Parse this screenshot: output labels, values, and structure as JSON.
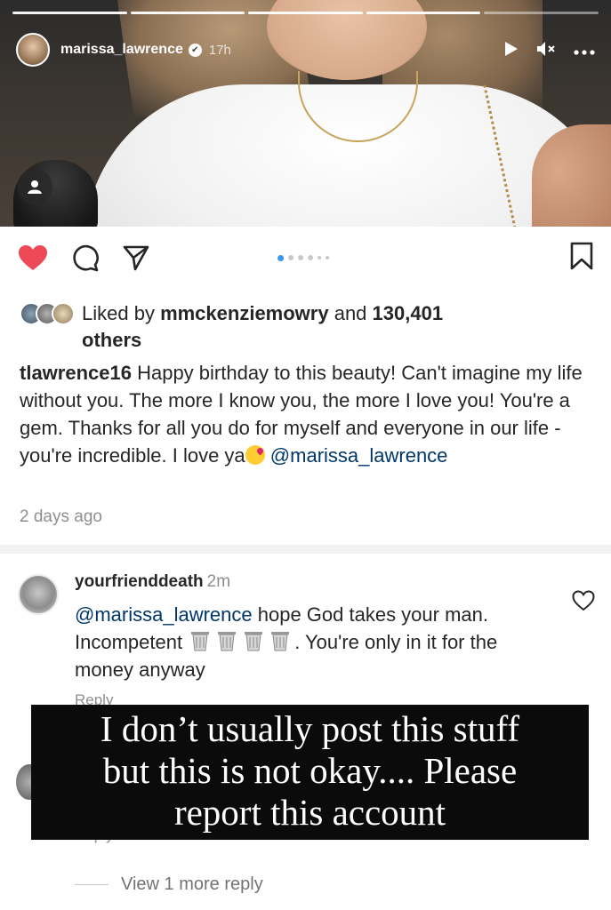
{
  "story": {
    "username": "marissa_lawrence",
    "time": "17h",
    "verified_mark": "✔",
    "progress_segments": [
      1,
      1,
      1,
      1,
      0
    ],
    "icons": [
      "play-icon",
      "mute-icon",
      "more-icon",
      "person-tag-icon"
    ]
  },
  "post": {
    "dots": [
      "active",
      "normal",
      "normal",
      "normal",
      "small",
      "small"
    ],
    "likes": {
      "prefix": "Liked by ",
      "user": "mmckenziemowry",
      "middle": " and ",
      "count": "130,401",
      "suffix": "others"
    },
    "caption": {
      "username": "tlawrence16",
      "text": " Happy birthday to this beauty! Can't imagine my life without you. The more I know you, the more I love you! You're a gem. Thanks for all you do for myself and everyone in our life - you're incredible. I love ya",
      "mention": "@marissa_lawrence"
    },
    "posted": "2 days ago"
  },
  "comment": {
    "username": "yourfrienddeath",
    "time": "2m",
    "mention": "@marissa_lawrence",
    "text_a": " hope God takes your man. Incompetent ",
    "text_b": ". You're only in it for the money anyway",
    "reply_label": "Reply",
    "reply_label_2": "Reply",
    "more_replies": "View 1 more reply"
  },
  "overlay": {
    "line1": "I don’t usually post this stuff",
    "line2": "but this is not okay.... Please",
    "line3": "report this account"
  },
  "colors": {
    "like_red": "#ed4956",
    "mention_blue": "#00376b",
    "dot_blue": "#3897f0",
    "muted_gray": "#8e8e8e"
  }
}
